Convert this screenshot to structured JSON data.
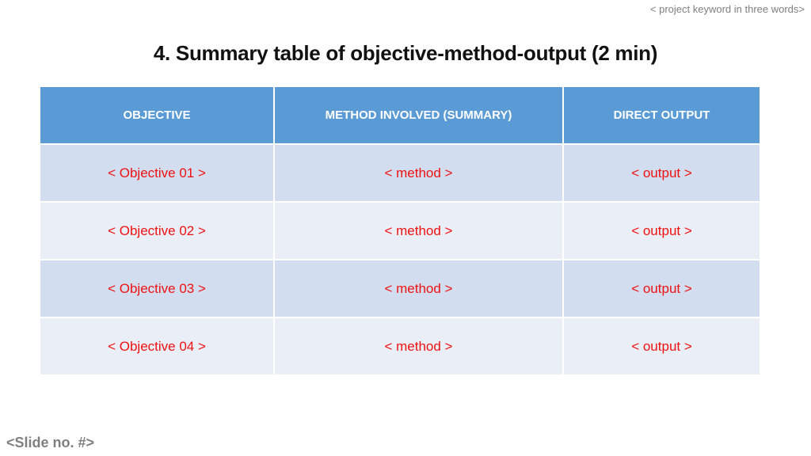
{
  "header": {
    "keyword": "< project keyword in three words>"
  },
  "title": "4. Summary table of objective-method-output (2 min)",
  "table": {
    "columns": [
      "OBJECTIVE",
      "METHOD INVOLVED (SUMMARY)",
      "DIRECT OUTPUT"
    ],
    "rows": [
      [
        "< Objective 01 >",
        "< method >",
        "< output >"
      ],
      [
        "< Objective 02 >",
        "< method >",
        "< output >"
      ],
      [
        "< Objective 03 >",
        "< method >",
        "< output >"
      ],
      [
        "< Objective 04 >",
        "< method >",
        "< output >"
      ]
    ]
  },
  "footer": {
    "slide_number": "<Slide no. #>"
  },
  "colors": {
    "header_fill": "#5b9bd5",
    "row_odd_fill": "#d2deef",
    "row_even_fill": "#eaeff7",
    "placeholder_text": "#ee1111",
    "muted_text": "#7f7f7f"
  }
}
